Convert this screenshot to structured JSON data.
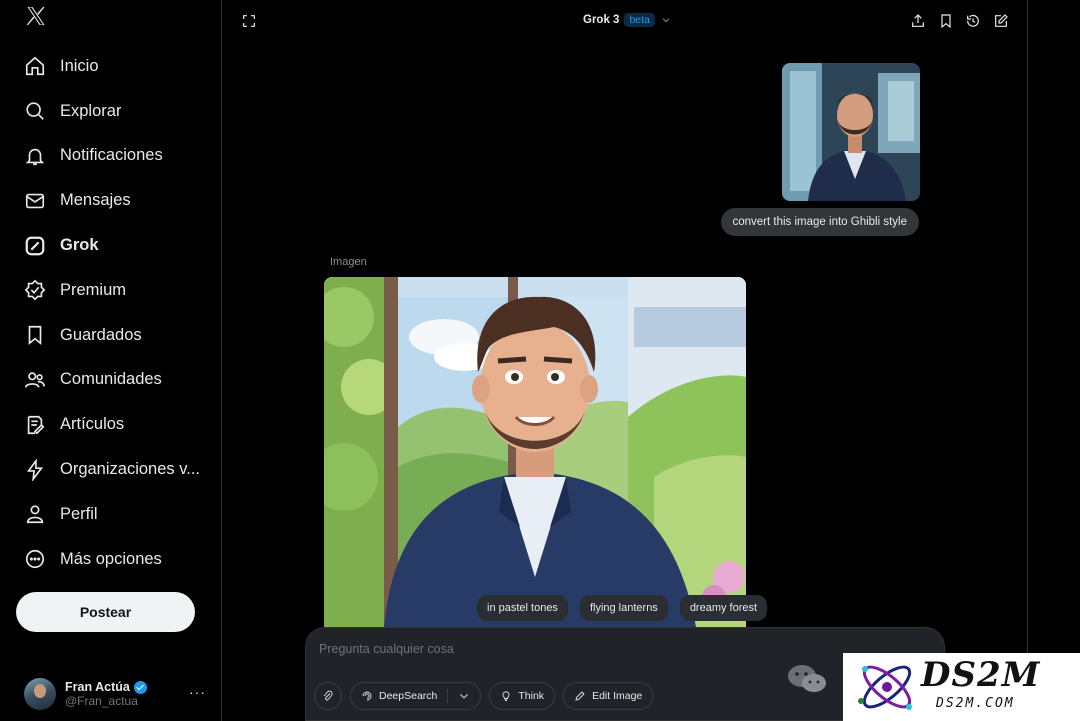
{
  "sidebar": {
    "logo": "x-logo",
    "items": [
      {
        "label": "Inicio",
        "icon": "home-icon"
      },
      {
        "label": "Explorar",
        "icon": "search-icon"
      },
      {
        "label": "Notificaciones",
        "icon": "bell-icon"
      },
      {
        "label": "Mensajes",
        "icon": "envelope-icon"
      },
      {
        "label": "Grok",
        "icon": "grok-icon",
        "active": true
      },
      {
        "label": "Premium",
        "icon": "badge-check-icon"
      },
      {
        "label": "Guardados",
        "icon": "bookmark-icon"
      },
      {
        "label": "Comunidades",
        "icon": "people-icon"
      },
      {
        "label": "Artículos",
        "icon": "article-icon"
      },
      {
        "label": "Organizaciones v...",
        "icon": "lightning-icon"
      },
      {
        "label": "Perfil",
        "icon": "person-icon"
      },
      {
        "label": "Más opciones",
        "icon": "more-circle-icon"
      }
    ],
    "post_button": "Postear",
    "profile": {
      "name": "Fran Actúa",
      "handle": "@Fran_actua",
      "more": "···"
    }
  },
  "header": {
    "model": "Grok 3",
    "badge": "beta"
  },
  "chat": {
    "user_message": "convert this image into Ghibli style",
    "response_label": "Imagen",
    "suggestions": [
      "in pastel tones",
      "flying lanterns",
      "dreamy forest"
    ]
  },
  "composer": {
    "placeholder": "Pregunta cualquier cosa",
    "deepsearch": "DeepSearch",
    "think": "Think",
    "edit_image": "Edit Image"
  },
  "watermark": {
    "title": "DS2M",
    "sub": "DS2M.COM"
  },
  "colors": {
    "accent": "#1d9bf0",
    "background": "#000000",
    "bubble": "#333639"
  }
}
